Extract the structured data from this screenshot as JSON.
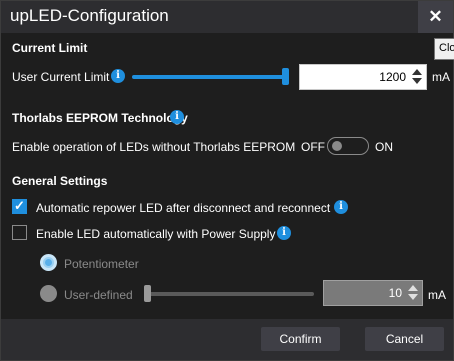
{
  "window": {
    "title": "upLED-Configuration",
    "close_glyph": "✕",
    "close_tooltip": "Close"
  },
  "current_limit": {
    "section_title": "Current Limit",
    "label": "User Current Limit",
    "value": "1200",
    "unit": "mA",
    "slider_level": 1.0
  },
  "eeprom": {
    "section_title": "Thorlabs EEPROM Technology",
    "label": "Enable operation of LEDs without Thorlabs EEPROM",
    "toggle_off_label": "OFF",
    "toggle_on_label": "ON",
    "toggle_state": "off"
  },
  "general": {
    "section_title": "General Settings",
    "auto_repower": {
      "label": "Automatic repower LED after disconnect and reconnect",
      "checked": true
    },
    "enable_power_supply": {
      "label": "Enable LED automatically with Power Supply",
      "checked": false
    },
    "radio_potentiometer": {
      "label": "Potentiometer",
      "selected": true
    },
    "radio_user_defined": {
      "label": "User-defined",
      "selected": false
    },
    "user_defined_value": "10",
    "user_defined_unit": "mA",
    "user_defined_slider_level": 0.0
  },
  "footer": {
    "confirm_label": "Confirm",
    "cancel_label": "Cancel"
  },
  "icons": {
    "info": "i",
    "check": "✓"
  },
  "colors": {
    "accent": "#1f8fde",
    "background": "#1e1e1e",
    "titlebar": "#2d2d30",
    "button": "#3f3f46"
  }
}
